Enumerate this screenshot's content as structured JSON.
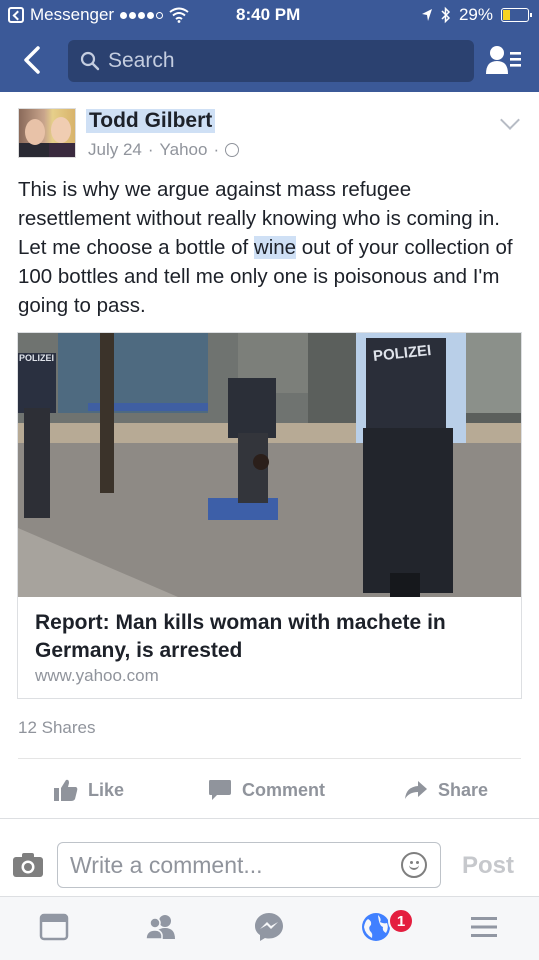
{
  "status_bar": {
    "back_app": "Messenger",
    "time": "8:40 PM",
    "battery": "29%",
    "battery_level": 0.29
  },
  "header": {
    "search_placeholder": "Search"
  },
  "post": {
    "author": "Todd Gilbert",
    "date": "July 24",
    "source": "Yahoo",
    "separator": "·",
    "text_before": "This is why we argue against mass refugee resettlement without really knowing who is coming in. Let me choose a bottle of ",
    "text_highlight": "wine",
    "text_after": " out of your collection of 100 bottles and tell me only one is poisonous and I'm going to pass.",
    "link": {
      "image_vest_left": "POLIZEI",
      "image_vest_right": "POLIZEI",
      "title": "Report: Man kills woman with machete in Germany, is arrested",
      "domain": "www.yahoo.com"
    },
    "shares": "12 Shares",
    "actions": {
      "like": "Like",
      "comment": "Comment",
      "share": "Share"
    }
  },
  "composer": {
    "placeholder": "Write a comment...",
    "post_label": "Post"
  },
  "tab_bar": {
    "notifications_badge": "1"
  },
  "colors": {
    "brand": "#3b5998",
    "badge": "#e41e3f",
    "highlight": "#cfe0f5"
  }
}
